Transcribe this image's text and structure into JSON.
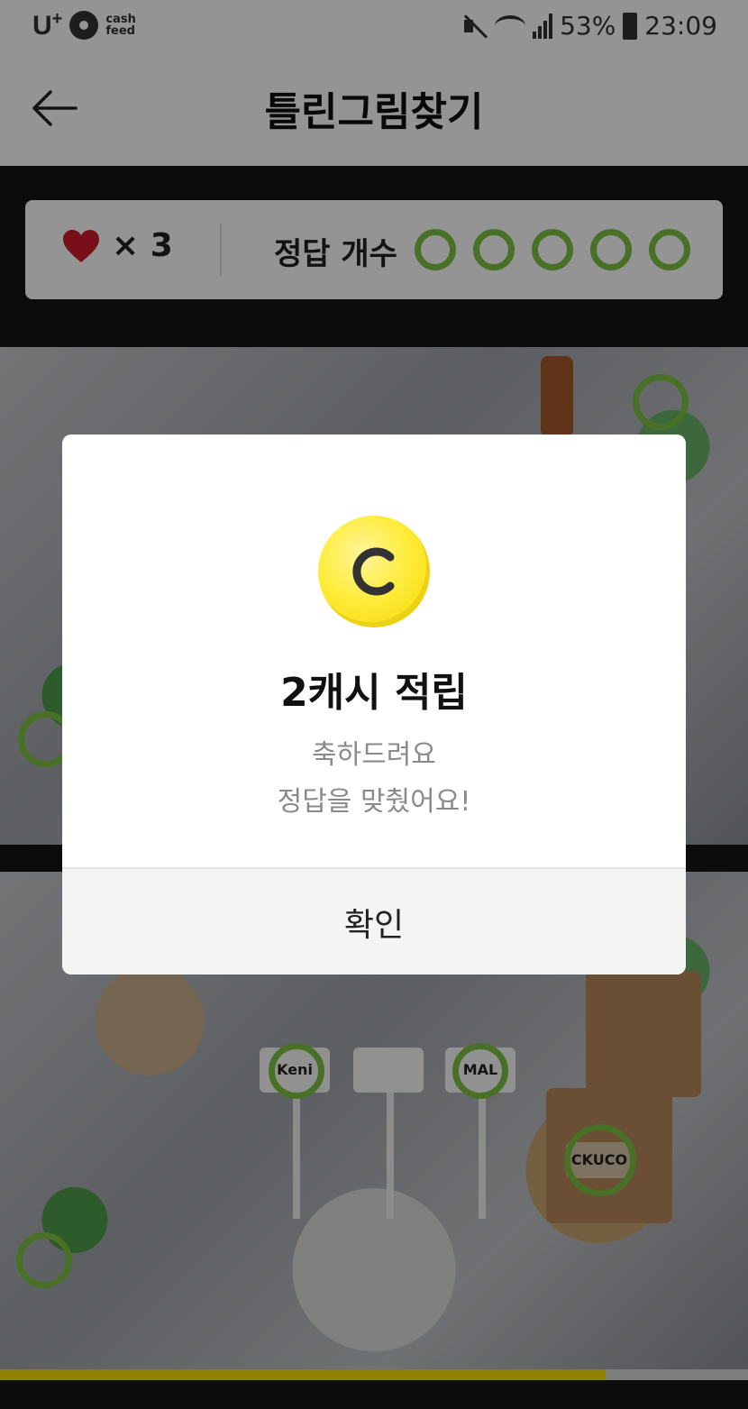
{
  "status_bar": {
    "carrier": "U",
    "carrier_plus": "+",
    "app_badge_top": "cash",
    "app_badge_bottom": "feed",
    "battery": "53%",
    "time": "23:09"
  },
  "header": {
    "title": "틀린그림찾기"
  },
  "info_bar": {
    "lives_multiplier": "× 3",
    "answer_label": "정답 개수",
    "answers_found": 5,
    "accent_color": "#7dc242"
  },
  "photo": {
    "tags": [
      "Keni",
      "",
      "MAL",
      "CKUCO"
    ]
  },
  "progress": {
    "fraction": 0.81
  },
  "dialog": {
    "coin_letter": "C",
    "title": "2캐시 적립",
    "message_line1": "축하드려요",
    "message_line2": "정답을 맞췄어요!",
    "confirm_label": "확인"
  }
}
